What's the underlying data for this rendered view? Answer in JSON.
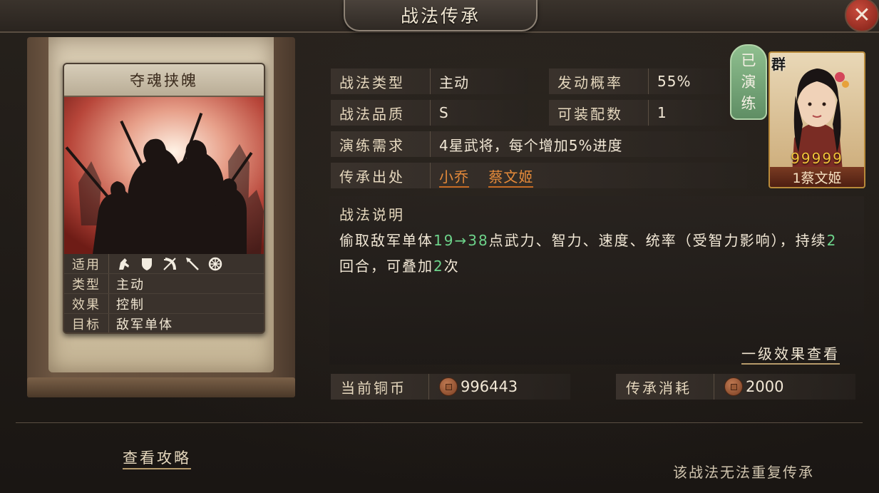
{
  "window": {
    "title": "战法传承",
    "close_icon": "close-icon"
  },
  "skill_card": {
    "name": "夺魂挟魄",
    "attributes": [
      {
        "key": "适用",
        "icons": [
          "cavalry-icon",
          "shield-icon",
          "bow-icon",
          "spear-icon",
          "chariot-icon"
        ]
      },
      {
        "key": "类型",
        "value": "主动"
      },
      {
        "key": "效果",
        "value": "控制"
      },
      {
        "key": "目标",
        "value": "敌军单体"
      }
    ]
  },
  "info": {
    "type_label": "战法类型",
    "type_value": "主动",
    "chance_label": "发动概率",
    "chance_value": "55%",
    "quality_label": "战法品质",
    "quality_value": "S",
    "equip_label": "可装配数",
    "equip_value": "1",
    "practice_label": "演练需求",
    "practice_value": "4星武将，每个增加5%进度",
    "origin_label": "传承出处",
    "origin_links": [
      "小乔",
      "蔡文姬"
    ]
  },
  "badge": {
    "chars": [
      "已",
      "演",
      "练"
    ]
  },
  "general": {
    "faction": "群",
    "stars": "99999",
    "name": "1蔡文姬"
  },
  "description": {
    "title": "战法说明",
    "part1": "偷取敌军单体",
    "range_from": "19",
    "arrow": "→",
    "range_to": "38",
    "part2": "点武力、智力、速度、统率（受智力影响），持续",
    "turns": "2",
    "part3": "回合，可叠加",
    "stacks": "2",
    "part4": "次",
    "level_link": "一级效果查看"
  },
  "currency": {
    "current_label": "当前铜币",
    "current_value": "996443",
    "cost_label": "传承消耗",
    "cost_value": "2000"
  },
  "footer": {
    "guide_link": "查看攻略",
    "note": "该战法无法重复传承"
  },
  "colors": {
    "accent_orange": "#e58a3a",
    "highlight_green": "#6dd38a",
    "badge_green": "#5f8e64",
    "close_red": "#c94b3c"
  }
}
